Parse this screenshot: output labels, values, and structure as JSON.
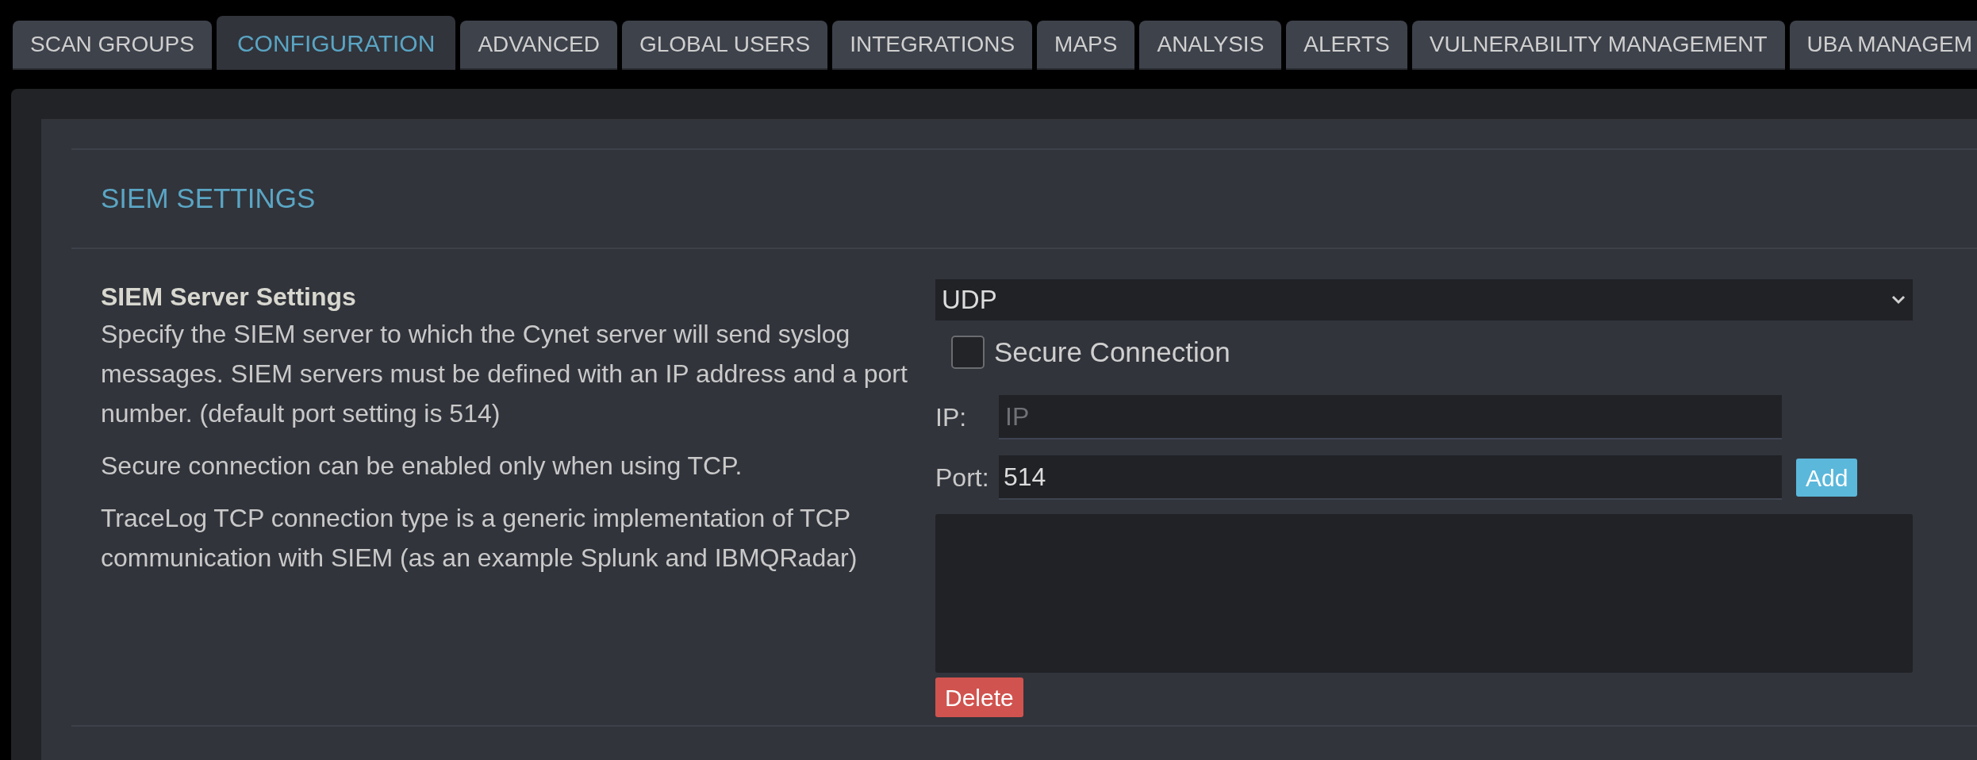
{
  "tabs": [
    {
      "label": "SCAN GROUPS",
      "selected": false
    },
    {
      "label": "CONFIGURATION",
      "selected": true
    },
    {
      "label": "ADVANCED",
      "selected": false
    },
    {
      "label": "GLOBAL USERS",
      "selected": false
    },
    {
      "label": "INTEGRATIONS",
      "selected": false
    },
    {
      "label": "MAPS",
      "selected": false
    },
    {
      "label": "ANALYSIS",
      "selected": false
    },
    {
      "label": "ALERTS",
      "selected": false
    },
    {
      "label": "VULNERABILITY MANAGEMENT",
      "selected": false
    },
    {
      "label": "UBA MANAGEM",
      "selected": false
    }
  ],
  "section_title": "SIEM SETTINGS",
  "description": {
    "title": "SIEM Server Settings",
    "paragraphs": [
      "Specify the SIEM server to which the Cynet server will send syslog messages. SIEM servers must be defined with an IP address and a port number. (default port setting is 514)",
      "Secure connection can be enabled only when using TCP.",
      "TraceLog TCP connection type is a generic implementation of TCP communication with SIEM (as an example Splunk and IBMQRadar)"
    ]
  },
  "form": {
    "protocol": "UDP",
    "secure_connection": {
      "label": "Secure Connection",
      "checked": false
    },
    "ip": {
      "label": "IP:",
      "placeholder": "IP"
    },
    "port": {
      "label": "Port:",
      "value": "514"
    },
    "add_button": "Add",
    "delete_button": "Delete"
  }
}
